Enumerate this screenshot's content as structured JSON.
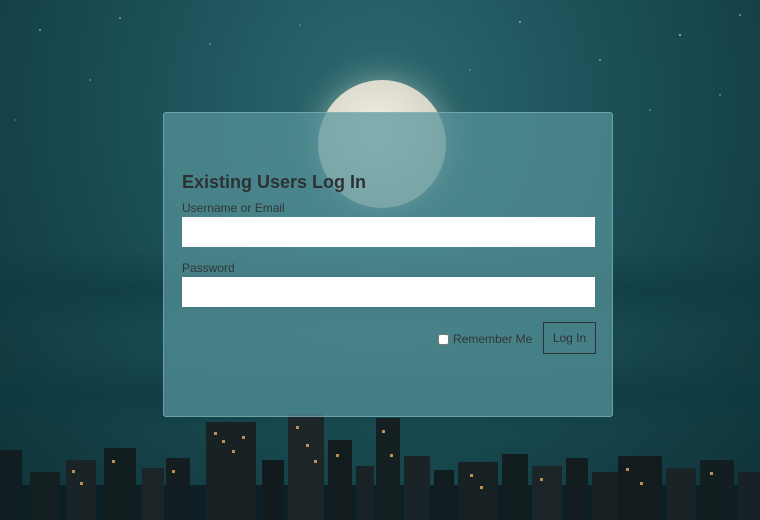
{
  "login": {
    "title": "Existing Users Log In",
    "username_label": "Username or Email",
    "username_value": "",
    "password_label": "Password",
    "password_value": "",
    "remember_label": "Remember Me",
    "remember_checked": false,
    "submit_label": "Log In"
  },
  "colors": {
    "panel": "#57949b",
    "sky": "#1f555c",
    "text": "#2c3234",
    "button_border": "#2d3436"
  }
}
